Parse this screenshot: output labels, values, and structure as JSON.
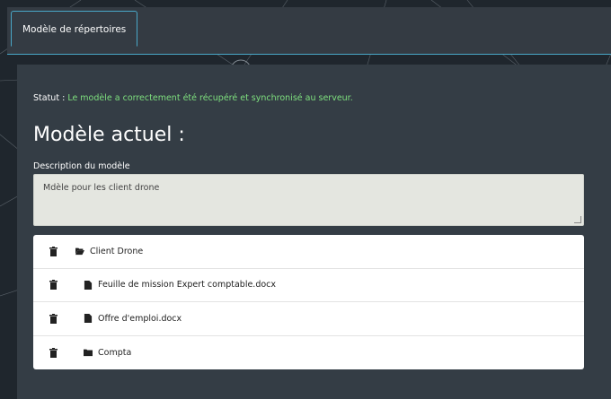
{
  "tab": {
    "label": "Modèle de répertoires"
  },
  "status": {
    "label": "Statut :",
    "message": "Le modèle a correctement été récupéré et synchronisé au serveur."
  },
  "title": "Modèle actuel :",
  "description": {
    "label": "Description du modèle",
    "value": "Mdèle pour les client drone"
  },
  "items": [
    {
      "name": "Client Drone",
      "type": "folder-open"
    },
    {
      "name": "Feuille de mission Expert comptable.docx",
      "type": "file"
    },
    {
      "name": "Offre d'emploi.docx",
      "type": "file"
    },
    {
      "name": "Compta",
      "type": "folder"
    }
  ],
  "colors": {
    "accent": "#49a8c8",
    "status": "#7ee07e",
    "panel": "#343d45",
    "background": "#1f262d"
  }
}
